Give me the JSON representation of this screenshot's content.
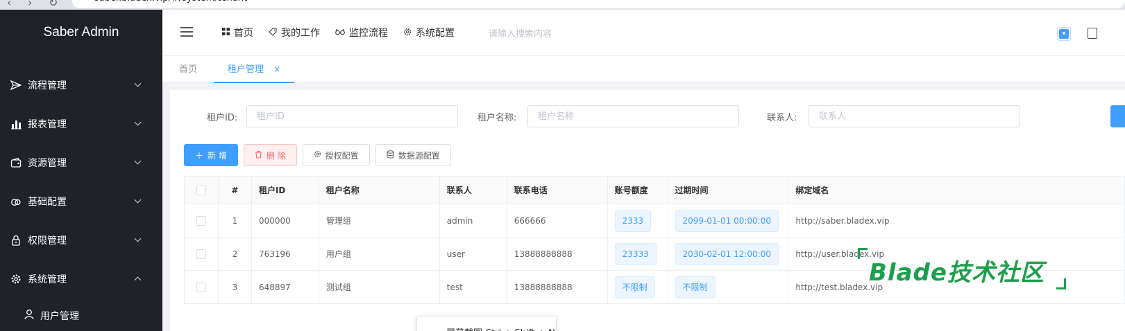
{
  "browser": {
    "url": "saber.bladex.vip/#/system/tenant",
    "nav_glyphs": [
      "‹",
      "›",
      "↻"
    ]
  },
  "sidebar": {
    "logo": "Saber Admin",
    "items": [
      {
        "label": "流程管理",
        "icon": "send-icon",
        "expanded": false
      },
      {
        "label": "报表管理",
        "icon": "bar-chart-icon",
        "expanded": false
      },
      {
        "label": "资源管理",
        "icon": "wallet-icon",
        "expanded": false
      },
      {
        "label": "基础配置",
        "icon": "link-icon",
        "expanded": false
      },
      {
        "label": "权限管理",
        "icon": "lock-icon",
        "expanded": false
      },
      {
        "label": "系统管理",
        "icon": "gear-icon",
        "expanded": true
      }
    ],
    "subitems": [
      {
        "label": "用户管理",
        "icon": "user-icon"
      }
    ]
  },
  "header": {
    "nav": [
      {
        "label": "首页",
        "icon": "grid-icon"
      },
      {
        "label": "我的工作",
        "icon": "tag-icon"
      },
      {
        "label": "监控流程",
        "icon": "glasses-icon"
      },
      {
        "label": "系统配置",
        "icon": "gear-icon"
      }
    ],
    "search_placeholder": "请输入搜索内容"
  },
  "tags": [
    {
      "label": "首页",
      "active": false
    },
    {
      "label": "租户管理",
      "active": true,
      "close": "×"
    }
  ],
  "search_form": {
    "tenant_id": {
      "label": "租户ID:",
      "placeholder": "租户ID"
    },
    "tenant_name": {
      "label": "租户名称:",
      "placeholder": "租户名称"
    },
    "contact": {
      "label": "联系人:",
      "placeholder": "联系人"
    }
  },
  "toolbar": {
    "add": "新 增",
    "delete": "删 除",
    "auth_config": "授权配置",
    "datasource_config": "数据源配置"
  },
  "table": {
    "columns": [
      "#",
      "租户ID",
      "租户名称",
      "联系人",
      "联系电话",
      "账号额度",
      "过期时间",
      "绑定域名"
    ],
    "rows": [
      {
        "index": "1",
        "tenant_id": "000000",
        "tenant_name": "管理组",
        "contact": "admin",
        "phone": "666666",
        "quota": "2333",
        "expire": "2099-01-01 00:00:00",
        "domain": "http://saber.bladex.vip"
      },
      {
        "index": "2",
        "tenant_id": "763196",
        "tenant_name": "用户组",
        "contact": "user",
        "phone": "13888888888",
        "quota": "23333",
        "expire": "2030-02-01 12:00:00",
        "domain": "http://user.bladex.vip"
      },
      {
        "index": "3",
        "tenant_id": "648897",
        "tenant_name": "测试组",
        "contact": "test",
        "phone": "13888888888",
        "quota": "不限制",
        "expire": "不限制",
        "domain": "http://test.bladex.vip"
      }
    ]
  },
  "watermark": "Blade技术社区",
  "tooltip": "屏幕截图 Ctrl + Shift + N",
  "colors": {
    "primary": "#409eff",
    "sidebar_bg": "#20222a",
    "danger": "#f56c6c",
    "watermark": "#1d9e4d"
  }
}
